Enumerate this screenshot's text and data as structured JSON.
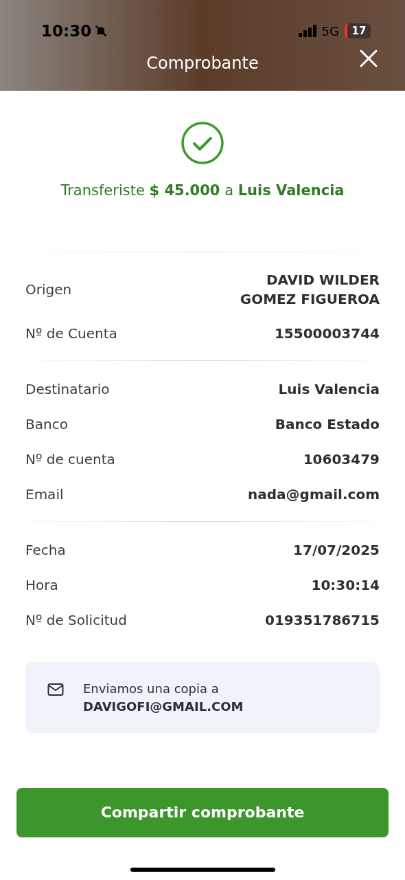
{
  "status_bar": {
    "time": "10:30",
    "network": "5G",
    "battery": "17"
  },
  "header": {
    "title": "Comprobante"
  },
  "result": {
    "message": "Transferiste **$ 45.000** a **Luis Valencia**"
  },
  "sections": [
    {
      "rows": [
        {
          "label": "Origen",
          "value": "DAVID WILDER\nGOMEZ FIGUEROA"
        },
        {
          "label": "Nº de Cuenta",
          "value": "15500003744"
        }
      ]
    },
    {
      "rows": [
        {
          "label": "Destinatario",
          "value": "Luis Valencia"
        },
        {
          "label": "Banco",
          "value": "Banco Estado"
        },
        {
          "label": "Nº de cuenta",
          "value": "10603479"
        },
        {
          "label": "Email",
          "value": "nada@gmail.com"
        }
      ]
    },
    {
      "rows": [
        {
          "label": "Fecha",
          "value": "17/07/2025"
        },
        {
          "label": "Hora",
          "value": "10:30:14"
        },
        {
          "label": "Nº de Solicitud",
          "value": "019351786715"
        }
      ]
    }
  ],
  "notice": {
    "text": "Enviamos una copia a",
    "email": "DAVIGOFI@GMAIL.COM"
  },
  "primary_button": "Compartir comprobante"
}
